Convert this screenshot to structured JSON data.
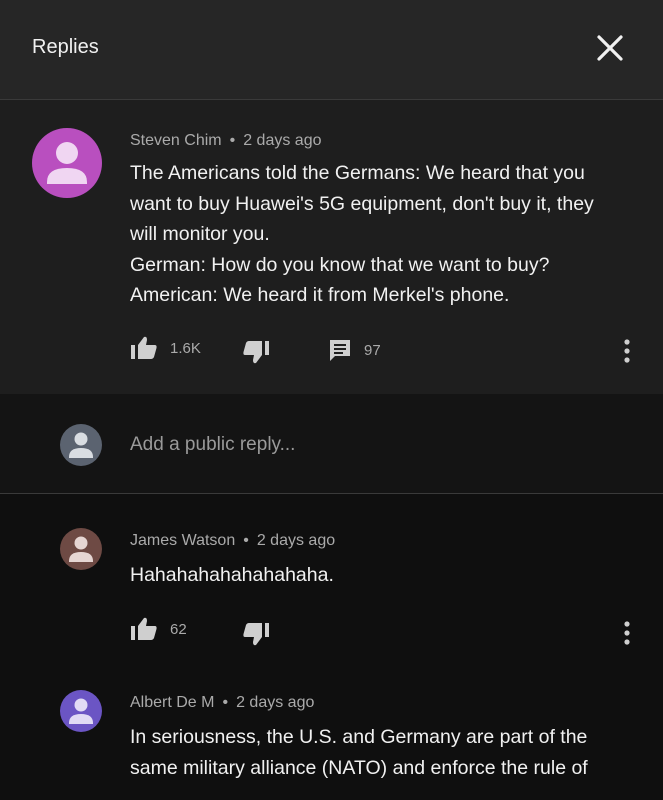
{
  "header": {
    "title": "Replies",
    "close_icon": "close-icon"
  },
  "main_comment": {
    "avatar_color": "#b94fbf",
    "author": "Steven Chim",
    "separator": "•",
    "time": "2 days ago",
    "lines": [
      "The Americans told the Germans: We heard that you",
      "want to buy Huawei's 5G equipment, don't buy it, they",
      "will monitor you.",
      "German: How do you know that we want to buy?",
      "American: We heard it from Merkel's phone."
    ],
    "likes": "1.6K",
    "replies_count": "97"
  },
  "reply_box": {
    "avatar_color": "#5b6370",
    "placeholder": "Add a public reply..."
  },
  "replies": [
    {
      "avatar_color": "#6e4a44",
      "author": "James Watson",
      "separator": "•",
      "time": "2 days ago",
      "lines": [
        "Hahahahahahahahaha."
      ],
      "likes": "62"
    },
    {
      "avatar_color": "#6b55c4",
      "author": "Albert De M",
      "separator": "•",
      "time": "2 days ago",
      "lines": [
        "In seriousness, the U.S. and Germany are part of the",
        "same military alliance (NATO) and enforce the rule of"
      ]
    }
  ],
  "colors": {
    "header_bg": "#262626",
    "comment_bg": "#1e1e1e",
    "text": "#f1f1f1",
    "secondary_text": "#aaaaaa"
  }
}
